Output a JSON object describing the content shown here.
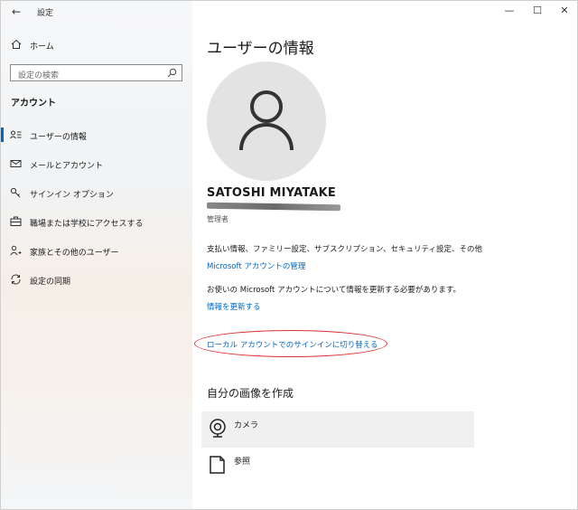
{
  "window": {
    "title": "設定",
    "back_icon": "back-arrow-icon",
    "controls": {
      "minimize": "—",
      "maximize": "☐",
      "close": "✕"
    }
  },
  "sidebar": {
    "home_label": "ホーム",
    "search_placeholder": "設定の検索",
    "section_label": "アカウント",
    "items": [
      {
        "label": "ユーザーの情報",
        "icon": "person-card-icon",
        "active": true
      },
      {
        "label": "メールとアカウント",
        "icon": "mail-icon",
        "active": false
      },
      {
        "label": "サインイン オプション",
        "icon": "key-icon",
        "active": false
      },
      {
        "label": "職場または学校にアクセスする",
        "icon": "briefcase-icon",
        "active": false
      },
      {
        "label": "家族とその他のユーザー",
        "icon": "person-add-icon",
        "active": false
      },
      {
        "label": "設定の同期",
        "icon": "sync-icon",
        "active": false
      }
    ]
  },
  "main": {
    "title": "ユーザーの情報",
    "user_name": "SATOSHI MIYATAKE",
    "user_role": "管理者",
    "billing_text": "支払い情報、ファミリー設定、サブスクリプション、セキュリティ設定、その他",
    "manage_link": "Microsoft アカウントの管理",
    "update_text": "お使いの Microsoft アカウントについて情報を更新する必要があります。",
    "update_link": "情報を更新する",
    "local_switch_link": "ローカル アカウントでのサインインに切り替える",
    "create_picture_title": "自分の画像を作成",
    "picture_options": [
      {
        "label": "カメラ",
        "icon": "camera-icon"
      },
      {
        "label": "参照",
        "icon": "browse-icon"
      }
    ]
  },
  "colors": {
    "accent": "#0067c0",
    "highlight_ellipse": "#e03030"
  }
}
